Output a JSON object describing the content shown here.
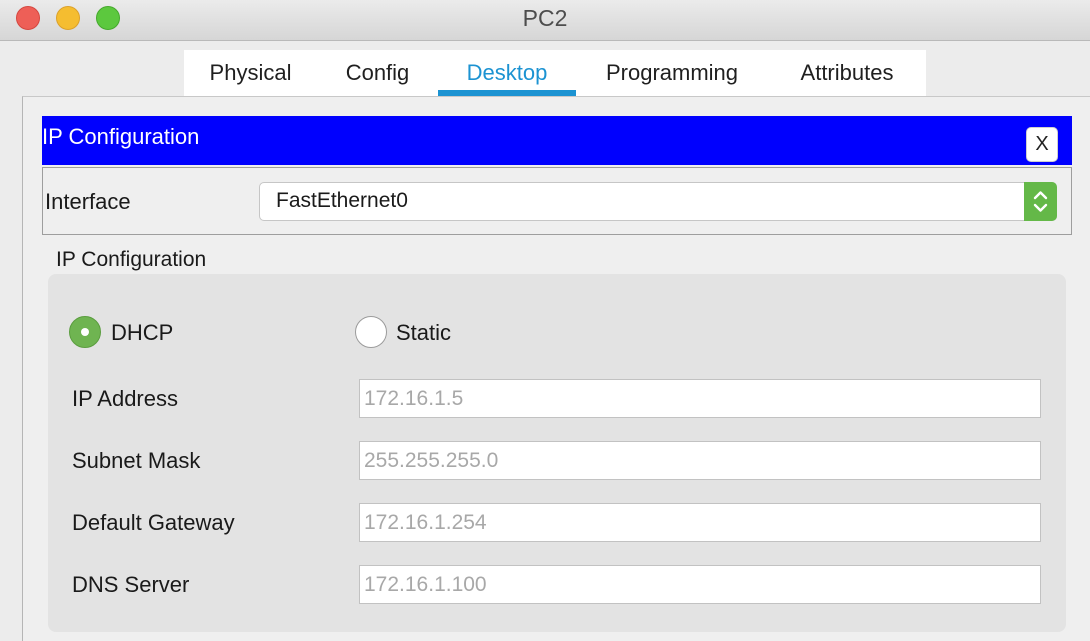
{
  "window": {
    "title": "PC2"
  },
  "tabs": [
    {
      "label": "Physical",
      "active": false
    },
    {
      "label": "Config",
      "active": false
    },
    {
      "label": "Desktop",
      "active": true
    },
    {
      "label": "Programming",
      "active": false
    },
    {
      "label": "Attributes",
      "active": false
    }
  ],
  "ip_panel": {
    "title": "IP Configuration",
    "close_label": "X",
    "interface_label": "Interface",
    "interface_value": "FastEthernet0",
    "section_label": "IP Configuration",
    "mode": {
      "dhcp_label": "DHCP",
      "static_label": "Static",
      "selected": "DHCP"
    },
    "fields": {
      "ip_address": {
        "label": "IP Address",
        "value": "172.16.1.5"
      },
      "subnet_mask": {
        "label": "Subnet Mask",
        "value": "255.255.255.0"
      },
      "default_gateway": {
        "label": "Default Gateway",
        "value": "172.16.1.254"
      },
      "dns_server": {
        "label": "DNS Server",
        "value": "172.16.1.100"
      }
    }
  },
  "colors": {
    "accent": "#1c93d2",
    "header_bar": "#0000fe",
    "radio_selected": "#6fb451",
    "select_arrow": "#64b848"
  },
  "icons": [
    "close-icon",
    "chevron-up-down-icon",
    "radio-selected-icon"
  ]
}
